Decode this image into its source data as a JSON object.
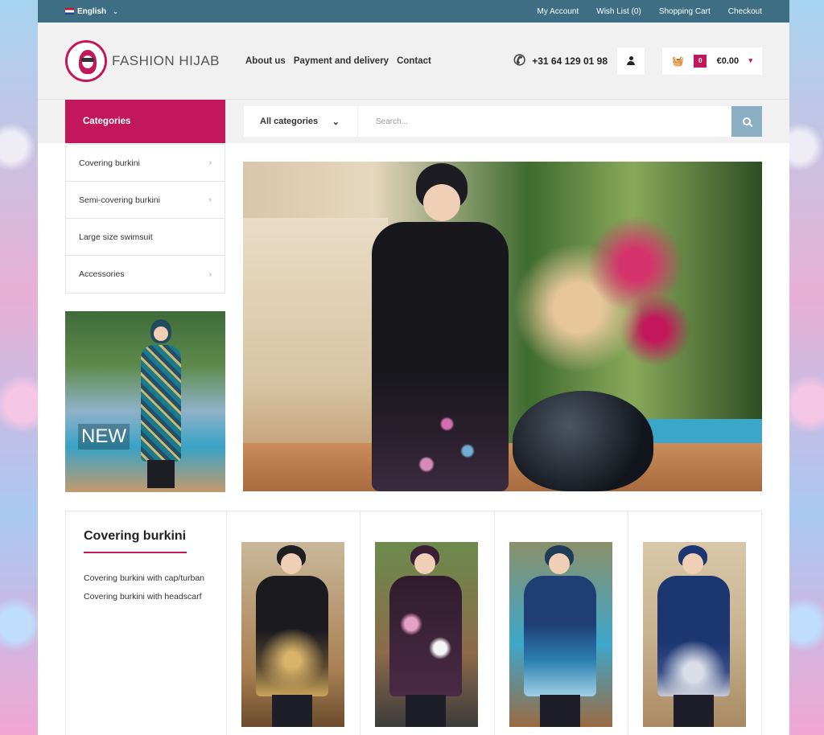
{
  "topbar": {
    "language": "English",
    "links": [
      "My Account",
      "Wish List (0)",
      "Shopping Cart",
      "Checkout"
    ]
  },
  "header": {
    "logo_text": "FASHION HIJAB",
    "nav": [
      "About us",
      "Payment and delivery",
      "Contact"
    ],
    "phone": "+31 64 129 01 98",
    "cart": {
      "count": "0",
      "total": "€0.00"
    }
  },
  "catbar": {
    "title": "Categories",
    "select_value": "All categories",
    "search_placeholder": "Search..."
  },
  "sidebar": {
    "categories": [
      {
        "label": "Covering burkini",
        "arrow": true
      },
      {
        "label": "Semi-covering burkini",
        "arrow": true
      },
      {
        "label": "Large size swimsuit",
        "arrow": false
      },
      {
        "label": "Accessories",
        "arrow": true
      }
    ],
    "promo_label": "NEW"
  },
  "products": {
    "title": "Covering burkini",
    "links": [
      "Covering burkini with cap/turban",
      "Covering burkini with headscarf"
    ],
    "items": [
      {
        "cap": "#1e1e22",
        "body": "radial-gradient(circle at 50% 70%, #d9b36a 0 10px, transparent 40px), linear-gradient(#1a1a1f 0 45%, #5a4a30 75%, #c9a35a)",
        "bg": "linear-gradient(#c9b89a, #a97f52 70%, #6b4c2e)"
      },
      {
        "cap": "#3b2036",
        "body": "radial-gradient(circle at 30% 40%, #e7a1c6 0 8px, transparent 14px), radial-gradient(circle at 70% 60%, #f5f5f5 0 8px, transparent 14px), linear-gradient(#2f1c2d, #4b2a44)",
        "bg": "linear-gradient(#6c8b4c, #8c6a4a 60%, #3c3c3c)"
      },
      {
        "cap": "#1f3b55",
        "body": "linear-gradient(#1f3f75 0 40%, #2b7fb0 70%, #9fd0e6)",
        "bg": "linear-gradient(#8a8f6a, #3ea7cb 55%, #9a6b42)"
      },
      {
        "cap": "#1b3670",
        "body": "radial-gradient(circle at 50% 80%, #d8dde8 0 12px, transparent 40px), linear-gradient(#1b3670 0 55%, #3b4f87 80%, #c7cbd8)",
        "bg": "linear-gradient(#d8c7a8, #c9b390 50%, #a98a62)"
      }
    ]
  }
}
